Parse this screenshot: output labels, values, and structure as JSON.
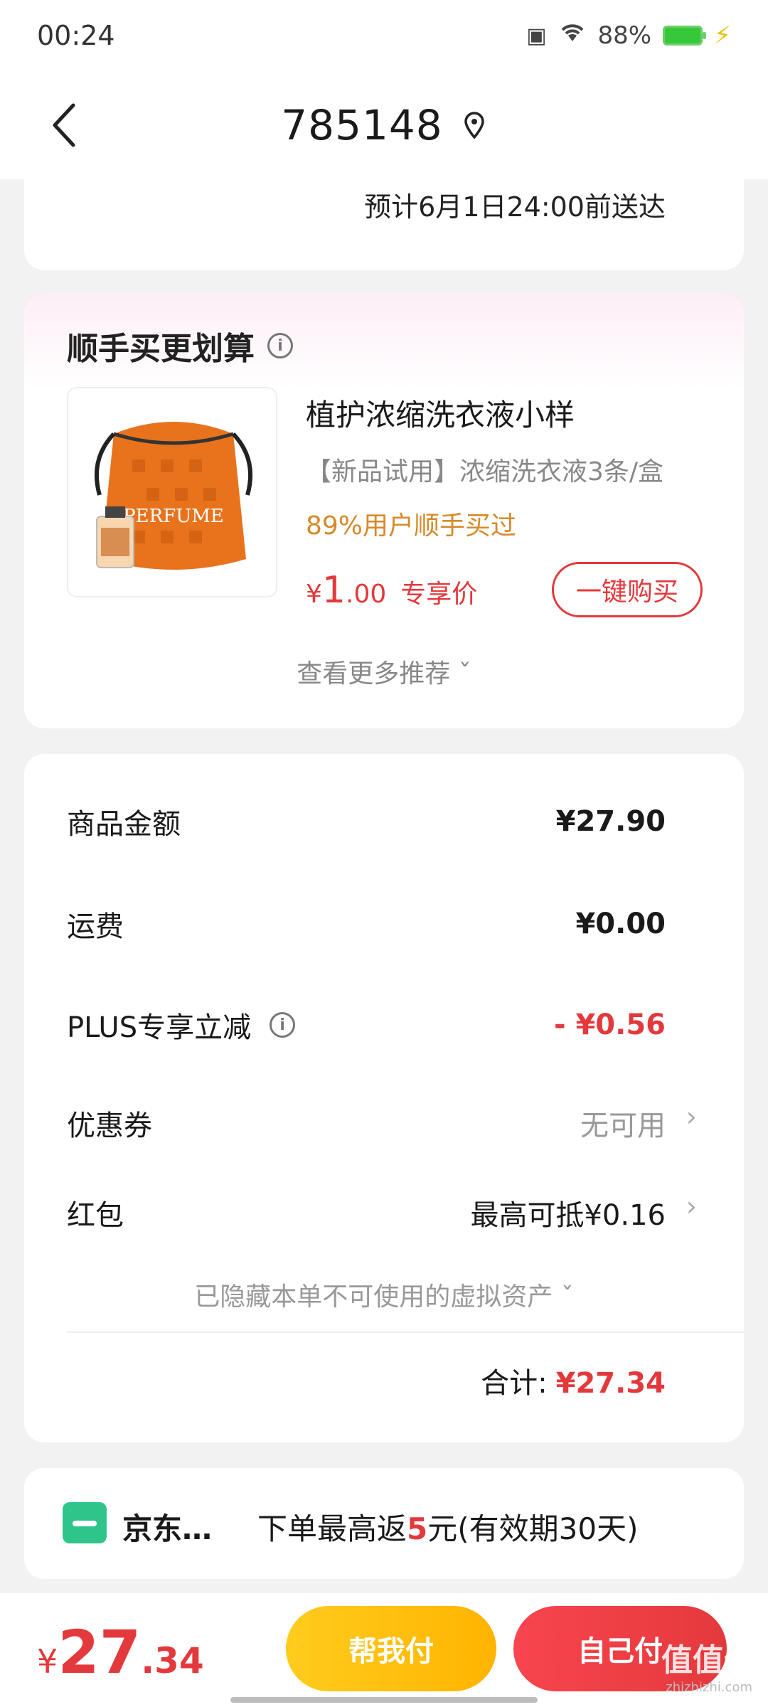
{
  "status_bar": {
    "time": "00:24",
    "battery": "88%",
    "icons": [
      "sim-off-icon",
      "wifi-icon",
      "battery-icon",
      "charging-icon"
    ]
  },
  "header": {
    "title": "785148"
  },
  "delivery": {
    "text": "预计6月1日24:00前送达"
  },
  "recommendation": {
    "title": "顺手买更划算",
    "product": {
      "name": "植护浓缩洗衣液小样",
      "desc": "【新品试用】浓缩洗衣液3条/盒",
      "social": "89%用户顺手买过",
      "price_symbol": "¥",
      "price_int": "1",
      "price_dec": ".00",
      "price_tag": "专享价",
      "buy_label": "一键购买",
      "image_text": "PERFUME"
    },
    "more_label": "查看更多推荐"
  },
  "summary": {
    "goods_label": "商品金额",
    "goods_value": "¥27.90",
    "shipping_label": "运费",
    "shipping_value": "¥0.00",
    "plus_label": "PLUS专享立减",
    "plus_value": "- ¥0.56",
    "coupon_label": "优惠券",
    "coupon_value": "无可用",
    "redpacket_label": "红包",
    "redpacket_value": "最高可抵¥0.16",
    "hidden_label": "已隐藏本单不可使用的虚拟资产",
    "total_label": "合计:",
    "total_value": "¥27.34"
  },
  "promo": {
    "name": "京东…",
    "text_before": "下单最高返",
    "text_highlight": "5",
    "text_after": "元(有效期30天)"
  },
  "bottom": {
    "price_symbol": "¥",
    "price_int": "27",
    "price_dec": ".34",
    "help_pay_label": "帮我付",
    "self_pay_label": "自己付",
    "watermark": "值值值",
    "watermark_sub": "zhizhizhi.com"
  },
  "colors": {
    "accent_red": "#e4393c",
    "accent_yellow": "#ffb400",
    "social_orange": "#d58a2a"
  }
}
